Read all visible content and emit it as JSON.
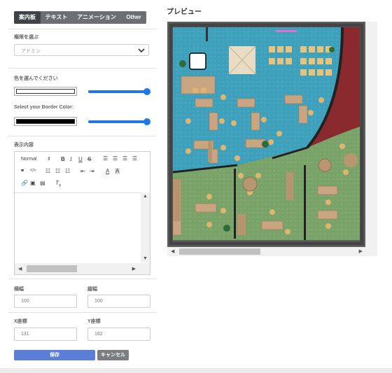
{
  "tabs": [
    "案内板",
    "テキスト",
    "アニメーション",
    "Other"
  ],
  "permission": {
    "label": "権限を選ぶ",
    "value": "アドミン"
  },
  "color": {
    "label": "色を選んでください",
    "value": "#ffffff"
  },
  "border_color": {
    "label": "Select your Border Color:",
    "value": "#000000"
  },
  "sliders": {
    "color_opacity": 1.0,
    "border_opacity": 1.0
  },
  "content": {
    "label": "表示内容",
    "format": "Normal"
  },
  "toolbar_icons": [
    "bold-icon",
    "italic-icon",
    "underline-icon",
    "strikethrough-icon",
    "align-left-icon",
    "align-center-icon",
    "align-right-icon",
    "align-justify-icon",
    "blockquote-icon",
    "code-block-icon",
    "ordered-list-icon",
    "bullet-list-icon",
    "checklist-icon",
    "indent-decrease-icon",
    "indent-increase-icon",
    "font-color-icon",
    "background-color-icon",
    "link-icon",
    "image-icon",
    "video-icon",
    "clear-format-icon"
  ],
  "width": {
    "label": "横幅",
    "value": "100"
  },
  "height": {
    "label": "縦幅",
    "value": "100"
  },
  "x": {
    "label": "X座標",
    "value": "131"
  },
  "y": {
    "label": "Y座標",
    "value": "182"
  },
  "buttons": {
    "save": "保存",
    "cancel": "キャンセル"
  },
  "preview": {
    "title": "プレビュー"
  },
  "colors": {
    "accent": "#1f77e8",
    "save_btn": "#5b7fd6",
    "cancel_btn": "#7a7e82",
    "tab_bg": "#6b6f74",
    "tab_active": "#3f4347"
  }
}
